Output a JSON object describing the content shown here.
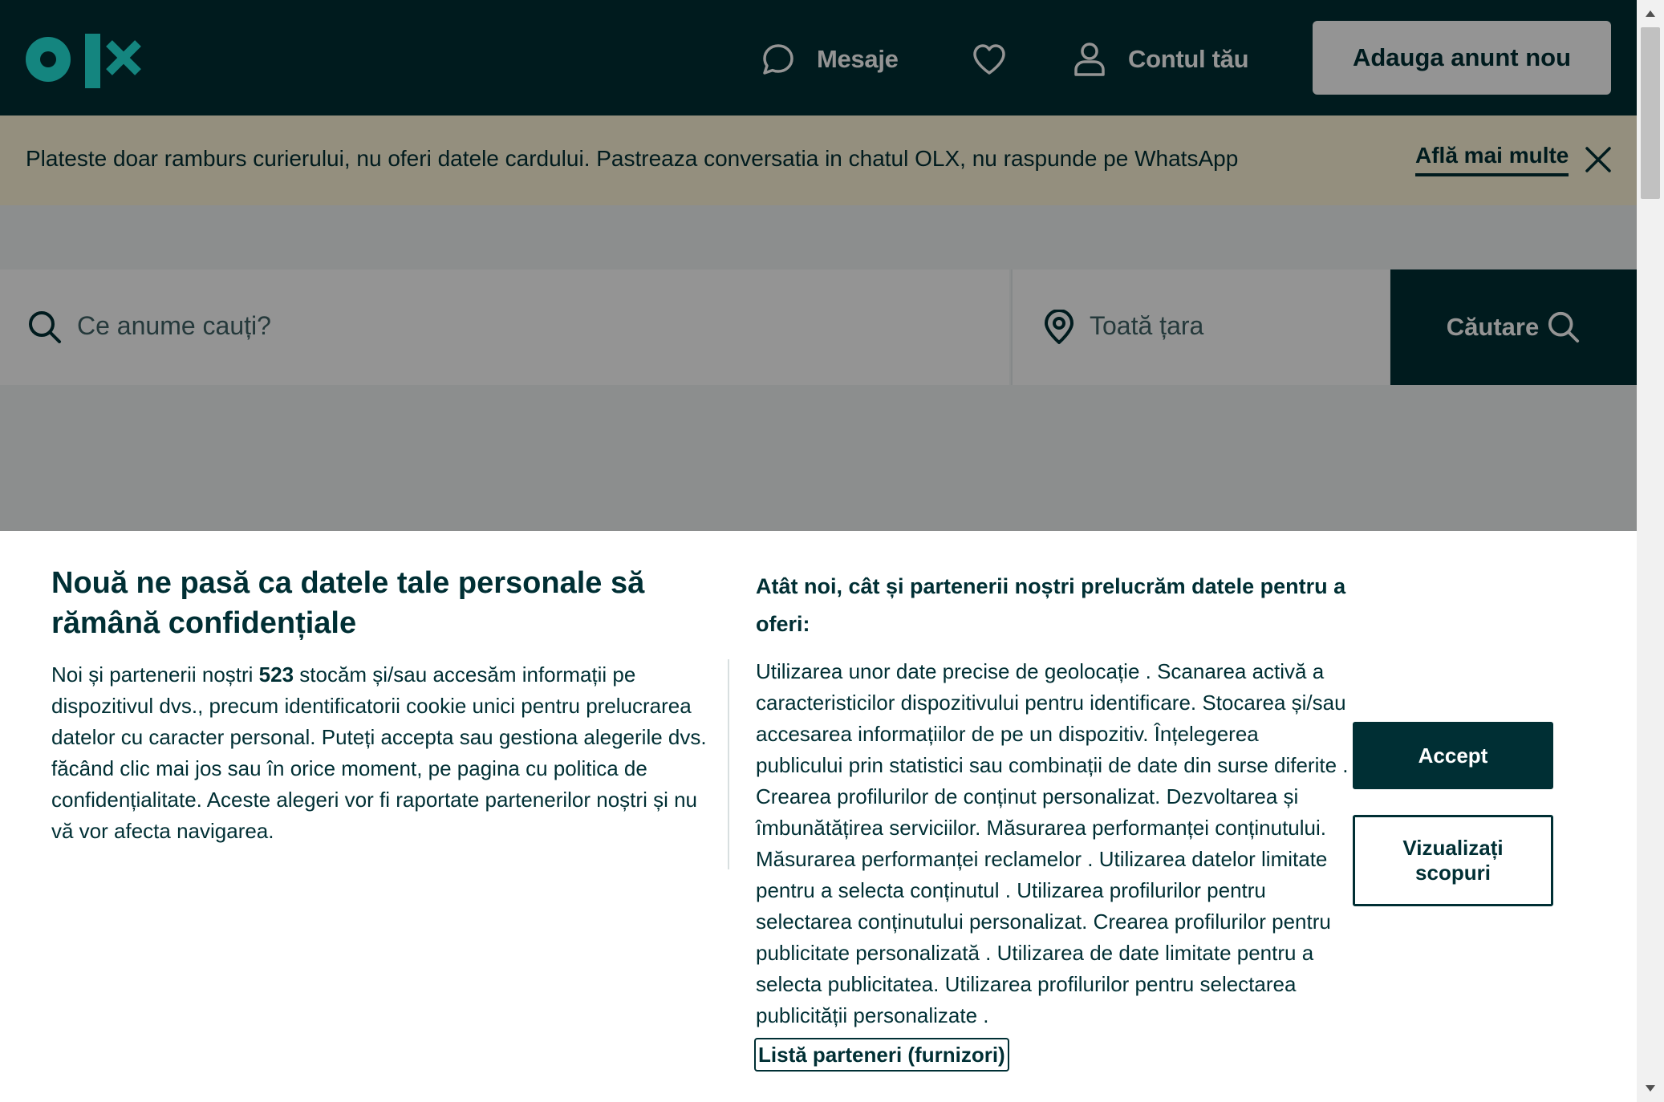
{
  "colors": {
    "brand_dark": "#002f34",
    "brand_teal": "#23e5db",
    "notice_bg": "#fff6d9",
    "page_bg": "#f2f4f5"
  },
  "header": {
    "logo_icon": "olx-logo",
    "messages_label": "Mesaje",
    "messages_icon": "chat-bubble-icon",
    "favorites_icon": "heart-icon",
    "account_label": "Contul tău",
    "account_icon": "user-icon",
    "add_ad_label": "Adauga anunt nou"
  },
  "notice": {
    "text": "Plateste doar ramburs curierului, nu oferi datele cardului. Pastreaza conversatia in chatul OLX, nu raspunde pe WhatsApp",
    "link_label": "Află mai multe",
    "close_icon": "close-icon"
  },
  "search": {
    "query_placeholder": "Ce anume cauți?",
    "location_placeholder": "Toată țara",
    "button_label": "Căutare",
    "search_icon": "search-icon",
    "location_icon": "location-pin-icon"
  },
  "consent": {
    "title": "Nouă ne pasă ca datele tale personale să rămână confidențiale",
    "body_before_count": "Noi și partenerii noștri ",
    "partner_count": "523",
    "body_after_count": " stocăm și/sau accesăm informații pe dispozitivul dvs., precum identificatorii cookie unici pentru prelucrarea datelor cu caracter personal. Puteți accepta sau gestiona alegerile dvs. făcând clic mai jos sau în orice moment, pe pagina cu politica de confidențialitate. Aceste alegeri vor fi raportate partenerilor noștri și nu vă vor afecta navigarea.",
    "purposes_title": "Atât noi, cât și partenerii noștri prelucrăm datele pentru a oferi:",
    "purposes_text": "Utilizarea unor date precise de geolocație . Scanarea activă a caracteristicilor dispozitivului pentru identificare. Stocarea și/sau accesarea informațiilor de pe un dispozitiv. Înțelegerea publicului prin statistici sau combinații de date din surse diferite . Crearea profilurilor de conținut personalizat. Dezvoltarea și îmbunătățirea serviciilor. Măsurarea performanței conținutului. Măsurarea performanței reclamelor . Utilizarea datelor limitate pentru a selecta conținutul . Utilizarea profilurilor pentru selectarea conținutului personalizat. Crearea profilurilor pentru publicitate personalizată . Utilizarea de date limitate pentru a selecta publicitatea. Utilizarea profilurilor pentru selectarea publicității personalizate .",
    "partners_link": "Listă parteneri (furnizori)",
    "accept_label": "Accept",
    "view_purposes_label": "Vizualizați scopuri"
  }
}
